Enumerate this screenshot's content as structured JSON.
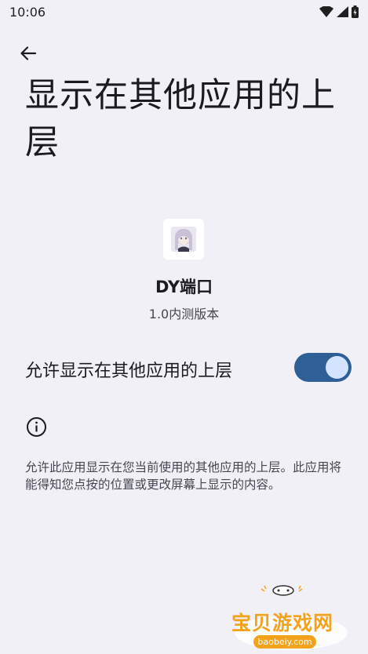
{
  "status_bar": {
    "time": "10:06"
  },
  "header": {
    "title": "显示在其他应用的上层"
  },
  "app": {
    "name": "DY端口",
    "version": "1.0内测版本"
  },
  "permission": {
    "label": "允许显示在其他应用的上层",
    "enabled": true
  },
  "info": {
    "description": "允许此应用显示在您当前使用的其他应用的上层。此应用将能得知您点按的位置或更改屏幕上显示的内容。"
  },
  "watermark": {
    "brand": "宝贝游戏网",
    "url": "baobeiy.com"
  },
  "colors": {
    "background": "#f1f0f7",
    "toggle_track": "#2e5f96",
    "toggle_thumb": "#d4e3ff",
    "watermark": "#f2a21b"
  }
}
